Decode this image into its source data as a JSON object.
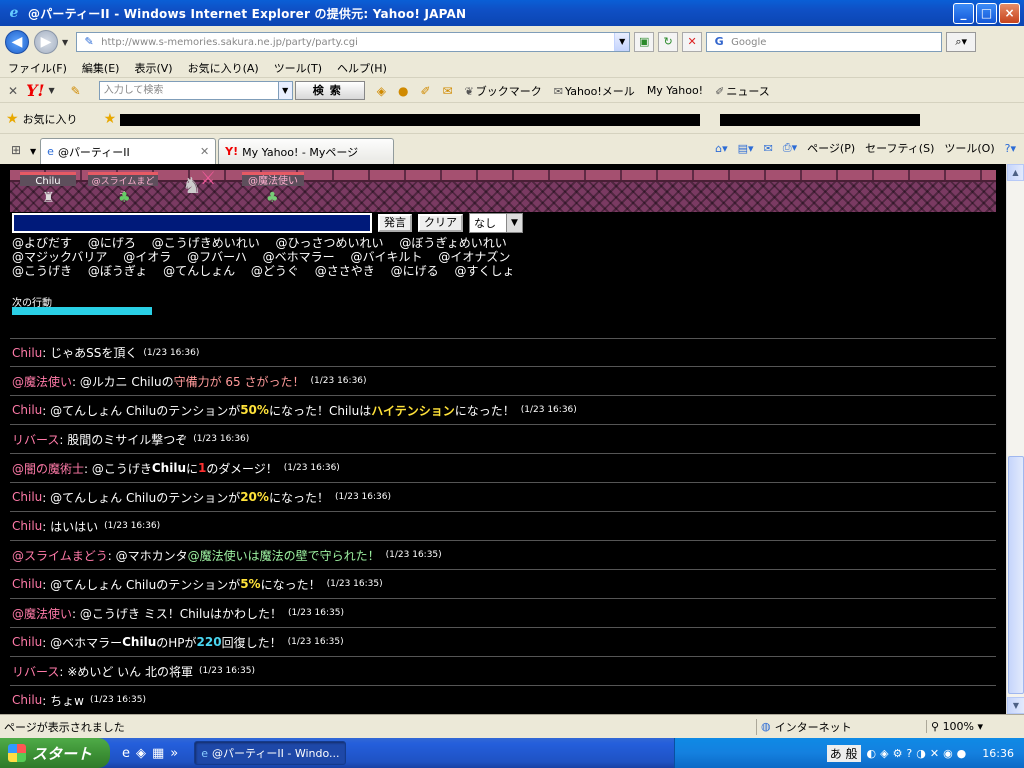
{
  "window": {
    "title": "@パーティーII - Windows Internet Explorer の提供元: Yahoo! JAPAN",
    "minimize": "_",
    "maximize": "□",
    "close": "×"
  },
  "address_bar": {
    "url": "http://www.s-memories.sakura.ne.jp/party/party.cgi",
    "search_placeholder": "Google"
  },
  "menu": [
    "ファイル(F)",
    "編集(E)",
    "表示(V)",
    "お気に入り(A)",
    "ツール(T)",
    "ヘルプ(H)"
  ],
  "yahoo_toolbar": {
    "search_placeholder": "入力して検索",
    "search_button": "検索",
    "links": [
      "ブックマーク",
      "Yahoo!メール",
      "My Yahoo!",
      "ニュース"
    ]
  },
  "favorites_bar": {
    "label": "お気に入り"
  },
  "tabs": [
    {
      "label": "@パーティーII",
      "active": true
    },
    {
      "label": "My Yahoo! - Myページ",
      "active": false
    }
  ],
  "tab_tools": [
    "ページ(P)",
    "セーフティ(S)",
    "ツール(O)"
  ],
  "game": {
    "characters": [
      {
        "name": "Chilu"
      },
      {
        "name": "@スライムまどう"
      },
      {
        "name": "@魔法使い"
      }
    ],
    "send_button": "発言",
    "clear_button": "クリア",
    "target_select": "なし",
    "command_rows": [
      [
        "@よびだす",
        "@にげろ",
        "@こうげきめいれい",
        "@ひっさつめいれい",
        "@ぼうぎょめいれい"
      ],
      [
        "@マジックバリア",
        "@イオラ",
        "@フバーハ",
        "@ベホマラー",
        "@バイキルト",
        "@イオナズン"
      ],
      [
        "@こうげき",
        "@ぼうぎょ",
        "@てんしょん",
        "@どうぐ",
        "@ささやき",
        "@にげる",
        "@すくしょ"
      ]
    ],
    "next_action_label": "次の行動",
    "next_action_progress": 1.0,
    "log": [
      {
        "name": "Chilu",
        "segments": [
          {
            "t": ": じゃあSSを頂く"
          }
        ],
        "time": "(1/23 16:36)"
      },
      {
        "name": "@魔法使い",
        "segments": [
          {
            "t": ": @ルカニ Chiluの"
          },
          {
            "t": "守備力が 65 さがった！",
            "c": "hl-pink"
          }
        ],
        "time": "(1/23 16:36)"
      },
      {
        "name": "Chilu",
        "segments": [
          {
            "t": ": @てんしょん Chiluのテンションが "
          },
          {
            "t": "50%",
            "c": "hl-yellow"
          },
          {
            "t": " になった！Chiluは"
          },
          {
            "t": "ハイテンション",
            "c": "hl-yellow"
          },
          {
            "t": "になった！"
          }
        ],
        "time": "(1/23 16:36)"
      },
      {
        "name": "リバース",
        "segments": [
          {
            "t": ": 股間のミサイル撃つぞ"
          }
        ],
        "time": "(1/23 16:36)"
      },
      {
        "name": "@闇の魔術士",
        "segments": [
          {
            "t": ": @こうげき "
          },
          {
            "t": "Chilu",
            "c": "bold"
          },
          {
            "t": "に "
          },
          {
            "t": "1",
            "c": "hl-red"
          },
          {
            "t": " のダメージ！"
          }
        ],
        "time": "(1/23 16:36)"
      },
      {
        "name": "Chilu",
        "segments": [
          {
            "t": ": @てんしょん Chiluのテンションが "
          },
          {
            "t": "20%",
            "c": "hl-yellow"
          },
          {
            "t": " になった！"
          }
        ],
        "time": "(1/23 16:36)"
      },
      {
        "name": "Chilu",
        "segments": [
          {
            "t": ": はいはい"
          }
        ],
        "time": "(1/23 16:36)"
      },
      {
        "name": "@スライムまどう",
        "segments": [
          {
            "t": ": @マホカンタ "
          },
          {
            "t": "@魔法使いは魔法の壁で守られた！",
            "c": "hl-green"
          }
        ],
        "time": "(1/23 16:35)"
      },
      {
        "name": "Chilu",
        "segments": [
          {
            "t": ": @てんしょん Chiluのテンションが "
          },
          {
            "t": "5%",
            "c": "hl-yellow"
          },
          {
            "t": " になった！"
          }
        ],
        "time": "(1/23 16:35)"
      },
      {
        "name": "@魔法使い",
        "segments": [
          {
            "t": ": @こうげき ミス！Chiluはかわした！"
          }
        ],
        "time": "(1/23 16:35)"
      },
      {
        "name": "Chilu",
        "segments": [
          {
            "t": ": @ベホマラー "
          },
          {
            "t": "Chilu",
            "c": "bold"
          },
          {
            "t": "のHPが "
          },
          {
            "t": "220",
            "c": "hl-cyan"
          },
          {
            "t": " 回復した！"
          }
        ],
        "time": "(1/23 16:35)"
      },
      {
        "name": "リバース",
        "segments": [
          {
            "t": ": ※めいど いん 北の将軍"
          }
        ],
        "time": "(1/23 16:35)"
      },
      {
        "name": "Chilu",
        "segments": [
          {
            "t": ": ちょw"
          }
        ],
        "time": "(1/23 16:35)"
      }
    ]
  },
  "status_bar": {
    "message": "ページが表示されました",
    "zone": "インターネット",
    "zoom": "100%"
  },
  "taskbar": {
    "start": "スタート",
    "window_item": "@パーティーII - Windo...",
    "clock": "16:36"
  },
  "colors": {
    "name_color": "#ff7aa8",
    "highlight_yellow": "#ffe23a",
    "highlight_cyan": "#4ad6f0",
    "highlight_red": "#ff3030",
    "progress_bar": "#2ad0e6"
  }
}
